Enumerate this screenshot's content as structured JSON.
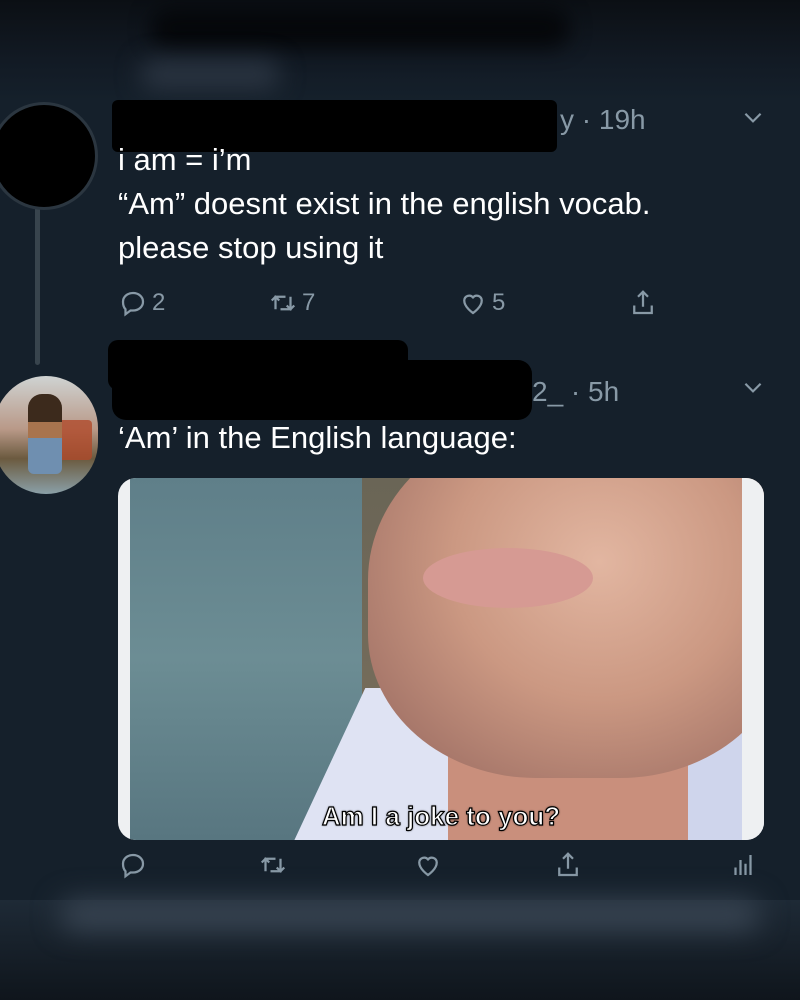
{
  "tweets": [
    {
      "meta": "y · 19h",
      "lines": [
        "i am = i’m",
        "“Am” doesnt exist in the english vocab.",
        "please stop using it"
      ],
      "actions": {
        "replies": "2",
        "retweets": "7",
        "likes": "5"
      }
    },
    {
      "meta": "2_ · 5h",
      "lines": [
        "‘Am’ in the English language:"
      ],
      "media": {
        "caption": "Am I a joke to you?"
      },
      "actions": {
        "replies": "",
        "retweets": "",
        "likes": ""
      }
    }
  ],
  "icons": {
    "chevron": "chevron-down-icon",
    "reply": "reply-icon",
    "retweet": "retweet-icon",
    "like": "heart-icon",
    "share": "share-icon",
    "analytics": "analytics-icon"
  },
  "colors": {
    "background": "#15202b",
    "text": "#ffffff",
    "muted": "#8899a6",
    "thread": "#38444d"
  }
}
